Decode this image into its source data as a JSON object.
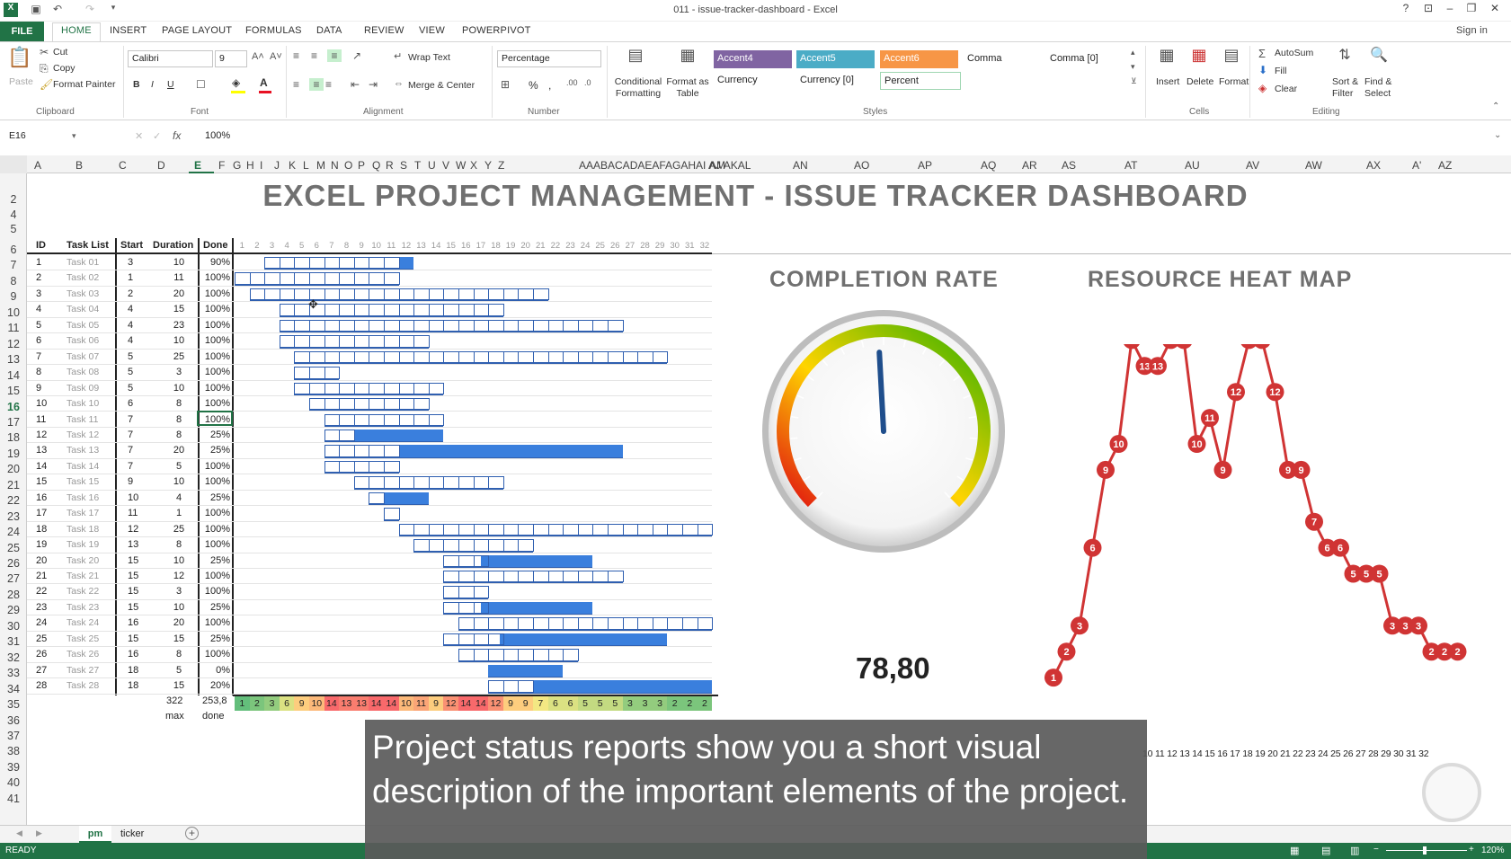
{
  "window": {
    "title": "011 - issue-tracker-dashboard - Excel",
    "signin": "Sign in",
    "help": "?"
  },
  "tabs": [
    "FILE",
    "HOME",
    "INSERT",
    "PAGE LAYOUT",
    "FORMULAS",
    "DATA",
    "REVIEW",
    "VIEW",
    "POWERPIVOT"
  ],
  "ribbon": {
    "clipboard": {
      "paste": "Paste",
      "cut": "Cut",
      "copy": "Copy",
      "format_painter": "Format Painter",
      "label": "Clipboard"
    },
    "font": {
      "name": "Calibri",
      "size": "9",
      "label": "Font",
      "bold": "B",
      "italic": "I",
      "underline": "U"
    },
    "alignment": {
      "wrap": "Wrap Text",
      "merge": "Merge & Center",
      "label": "Alignment"
    },
    "number": {
      "format": "Percentage",
      "label": "Number",
      "pct": "%",
      "comma": ","
    },
    "styles": {
      "conditional": "Conditional Formatting",
      "format_table": "Format as Table",
      "accent4": "Accent4",
      "accent5": "Accent5",
      "accent6": "Accent6",
      "comma": "Comma",
      "comma0": "Comma [0]",
      "currency": "Currency",
      "currency0": "Currency [0]",
      "percent": "Percent",
      "label": "Styles"
    },
    "cells": {
      "insert": "Insert",
      "delete": "Delete",
      "format": "Format",
      "label": "Cells"
    },
    "editing": {
      "autosum": "AutoSum",
      "fill": "Fill",
      "clear": "Clear",
      "sort": "Sort & Filter",
      "find": "Find & Select",
      "label": "Editing"
    }
  },
  "formula_bar": {
    "cell": "E16",
    "fx": "fx",
    "value": "100%"
  },
  "columns": [
    "A",
    "B",
    "C",
    "D",
    "E",
    "F",
    "G",
    "H",
    "I",
    "J",
    "K",
    "L",
    "M",
    "N",
    "O",
    "P",
    "Q",
    "R",
    "S",
    "T",
    "U",
    "V",
    "W",
    "X",
    "Y",
    "Z",
    "AAABACADAEAFAGAHAI AJ AKAL",
    "AM",
    "AN",
    "AO",
    "AP",
    "AQ",
    "AR",
    "AS",
    "AT",
    "AU",
    "AV",
    "AW",
    "AX",
    "A'",
    "AZ"
  ],
  "rows": [
    "2",
    "4",
    "5",
    "6",
    "7",
    "8",
    "9",
    "10",
    "11",
    "12",
    "13",
    "14",
    "15",
    "16",
    "17",
    "18",
    "19",
    "20",
    "21",
    "22",
    "23",
    "24",
    "25",
    "26",
    "27",
    "28",
    "29",
    "30",
    "31",
    "32",
    "33",
    "34",
    "35",
    "36",
    "37",
    "38",
    "39",
    "40",
    "41"
  ],
  "dashboard": {
    "title": "EXCEL PROJECT MANAGEMENT - ISSUE TRACKER DASHBOARD",
    "headers": {
      "id": "ID",
      "task": "Task List",
      "start": "Start",
      "duration": "Duration",
      "done": "Done"
    },
    "tasks": [
      {
        "id": "1",
        "name": "Task 01",
        "start": "3",
        "dur": "10",
        "done": "90%"
      },
      {
        "id": "2",
        "name": "Task 02",
        "start": "1",
        "dur": "11",
        "done": "100%"
      },
      {
        "id": "3",
        "name": "Task 03",
        "start": "2",
        "dur": "20",
        "done": "100%"
      },
      {
        "id": "4",
        "name": "Task 04",
        "start": "4",
        "dur": "15",
        "done": "100%"
      },
      {
        "id": "5",
        "name": "Task 05",
        "start": "4",
        "dur": "23",
        "done": "100%"
      },
      {
        "id": "6",
        "name": "Task 06",
        "start": "4",
        "dur": "10",
        "done": "100%"
      },
      {
        "id": "7",
        "name": "Task 07",
        "start": "5",
        "dur": "25",
        "done": "100%"
      },
      {
        "id": "8",
        "name": "Task 08",
        "start": "5",
        "dur": "3",
        "done": "100%"
      },
      {
        "id": "9",
        "name": "Task 09",
        "start": "5",
        "dur": "10",
        "done": "100%"
      },
      {
        "id": "10",
        "name": "Task 10",
        "start": "6",
        "dur": "8",
        "done": "100%"
      },
      {
        "id": "11",
        "name": "Task 11",
        "start": "7",
        "dur": "8",
        "done": "100%"
      },
      {
        "id": "12",
        "name": "Task 12",
        "start": "7",
        "dur": "8",
        "done": "25%"
      },
      {
        "id": "13",
        "name": "Task 13",
        "start": "7",
        "dur": "20",
        "done": "25%"
      },
      {
        "id": "14",
        "name": "Task 14",
        "start": "7",
        "dur": "5",
        "done": "100%"
      },
      {
        "id": "15",
        "name": "Task 15",
        "start": "9",
        "dur": "10",
        "done": "100%"
      },
      {
        "id": "16",
        "name": "Task 16",
        "start": "10",
        "dur": "4",
        "done": "25%"
      },
      {
        "id": "17",
        "name": "Task 17",
        "start": "11",
        "dur": "1",
        "done": "100%"
      },
      {
        "id": "18",
        "name": "Task 18",
        "start": "12",
        "dur": "25",
        "done": "100%"
      },
      {
        "id": "19",
        "name": "Task 19",
        "start": "13",
        "dur": "8",
        "done": "100%"
      },
      {
        "id": "20",
        "name": "Task 20",
        "start": "15",
        "dur": "10",
        "done": "25%"
      },
      {
        "id": "21",
        "name": "Task 21",
        "start": "15",
        "dur": "12",
        "done": "100%"
      },
      {
        "id": "22",
        "name": "Task 22",
        "start": "15",
        "dur": "3",
        "done": "100%"
      },
      {
        "id": "23",
        "name": "Task 23",
        "start": "15",
        "dur": "10",
        "done": "25%"
      },
      {
        "id": "24",
        "name": "Task 24",
        "start": "16",
        "dur": "20",
        "done": "100%"
      },
      {
        "id": "25",
        "name": "Task 25",
        "start": "15",
        "dur": "15",
        "done": "25%"
      },
      {
        "id": "26",
        "name": "Task 26",
        "start": "16",
        "dur": "8",
        "done": "100%"
      },
      {
        "id": "27",
        "name": "Task 27",
        "start": "18",
        "dur": "5",
        "done": "0%"
      },
      {
        "id": "28",
        "name": "Task 28",
        "start": "18",
        "dur": "15",
        "done": "20%"
      }
    ],
    "days": [
      "1",
      "2",
      "3",
      "4",
      "5",
      "6",
      "7",
      "8",
      "9",
      "10",
      "11",
      "12",
      "13",
      "14",
      "15",
      "16",
      "17",
      "18",
      "19",
      "20",
      "21",
      "22",
      "23",
      "24",
      "25",
      "26",
      "27",
      "28",
      "29",
      "30",
      "31",
      "32"
    ],
    "totals": {
      "duration": "322",
      "done": "253,8",
      "max": "max",
      "done_label": "done"
    },
    "heat": [
      1,
      2,
      3,
      6,
      9,
      10,
      14,
      13,
      13,
      14,
      14,
      10,
      11,
      9,
      12,
      14,
      14,
      12,
      9,
      9,
      7,
      6,
      6,
      5,
      5,
      5,
      3,
      3,
      3,
      2,
      2,
      2
    ],
    "heat_colors": {
      "green": "#63be7b",
      "yellow": "#ffeb84",
      "red": "#f8696b"
    },
    "gauge": {
      "title": "COMPLETION RATE",
      "value": "78,80",
      "rate": 0.788
    },
    "heatmap": {
      "title": "RESOURCE HEAT MAP",
      "axis_visible": "10 11 12 13 14 15 16 17 18 19 20 21 22 23 24 25 26 27 28 29 30 31 32"
    }
  },
  "chart_data": {
    "type": "line",
    "title": "RESOURCE HEAT MAP",
    "x": [
      1,
      2,
      3,
      4,
      5,
      6,
      7,
      8,
      9,
      10,
      11,
      12,
      13,
      14,
      15,
      16,
      17,
      18,
      19,
      20,
      21,
      22,
      23,
      24,
      25,
      26,
      27,
      28,
      29,
      30,
      31,
      32
    ],
    "series": [
      {
        "values": [
          1,
          2,
          3,
          6,
          9,
          10,
          14,
          13,
          13,
          14,
          14,
          10,
          11,
          9,
          12,
          14,
          14,
          12,
          9,
          9,
          7,
          6,
          6,
          5,
          5,
          5,
          3,
          3,
          3,
          2,
          2,
          2
        ]
      }
    ],
    "xlabel": "",
    "ylabel": "",
    "color": "#d03434"
  },
  "sheet_tabs": [
    "pm",
    "ticker"
  ],
  "status": {
    "ready": "READY",
    "zoom": "120%"
  },
  "caption": "Project status reports show you a short visual description of the important elements of the project.",
  "colors": {
    "excel_green": "#217346",
    "bar_blue": "#3a7fdd",
    "dot_red": "#d03434",
    "title_gray": "#707070"
  }
}
